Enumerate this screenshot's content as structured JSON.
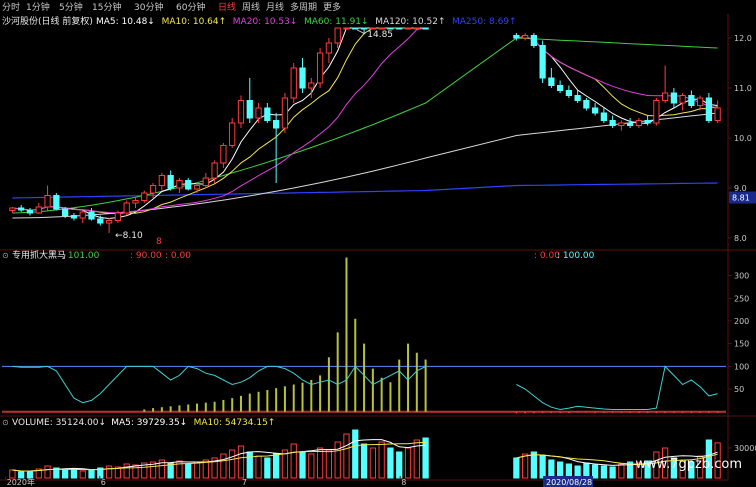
{
  "toolbar": {
    "periods": [
      "分时",
      "1分钟",
      "5分钟",
      "15分钟",
      "30分钟",
      "60分钟",
      "日线",
      "周线",
      "月线",
      "多周期",
      "更多"
    ],
    "active": "日线"
  },
  "colors": {
    "up": "#ff3b3b",
    "down": "#54ffff",
    "ma5": "#ffffff",
    "ma10": "#f2e64a",
    "ma20": "#e040e0",
    "ma60": "#3fd13f",
    "ma120": "#d8d8d8",
    "ma250": "#3040ff",
    "ind_line": "#3fd0d0",
    "ind_bar": "#b7c23a",
    "ind_ref": "#5a8cff"
  },
  "chart_data": [
    {
      "type": "candlestick",
      "title": "沙河股份(日线 前复权)",
      "indicators": [
        {
          "name": "MA5",
          "value": "10.48",
          "arrow": "↓"
        },
        {
          "name": "MA10",
          "value": "10.64",
          "arrow": "↑"
        },
        {
          "name": "MA20",
          "value": "10.53",
          "arrow": "↓"
        },
        {
          "name": "MA60",
          "value": "11.91",
          "arrow": "↓"
        },
        {
          "name": "MA120",
          "value": "10.52",
          "arrow": "↑"
        },
        {
          "name": "MA250",
          "value": "8.69",
          "arrow": "↑"
        }
      ],
      "y_ticks": [
        "12.0",
        "11.0",
        "10.0",
        "9.0",
        "8.0"
      ],
      "ylim": [
        7.8,
        12.2
      ],
      "annotations": {
        "high": "14.85",
        "low": "8.10",
        "marker": "8",
        "price_tag": "8.81"
      },
      "segments": [
        {
          "start": 0,
          "count": 48,
          "gap_after": true
        },
        {
          "start": 48,
          "count": 24
        }
      ],
      "candles_seg1": [
        [
          8.55,
          8.62,
          8.5,
          8.6
        ],
        [
          8.6,
          8.66,
          8.52,
          8.56
        ],
        [
          8.56,
          8.6,
          8.45,
          8.5
        ],
        [
          8.5,
          8.7,
          8.48,
          8.62
        ],
        [
          8.62,
          9.05,
          8.55,
          8.85
        ],
        [
          8.85,
          8.9,
          8.55,
          8.58
        ],
        [
          8.58,
          8.62,
          8.4,
          8.45
        ],
        [
          8.45,
          8.5,
          8.35,
          8.4
        ],
        [
          8.4,
          8.55,
          8.3,
          8.52
        ],
        [
          8.52,
          8.6,
          8.35,
          8.38
        ],
        [
          8.38,
          8.45,
          8.25,
          8.3
        ],
        [
          8.3,
          8.4,
          8.1,
          8.35
        ],
        [
          8.35,
          8.55,
          8.3,
          8.5
        ],
        [
          8.5,
          8.75,
          8.45,
          8.7
        ],
        [
          8.7,
          8.8,
          8.6,
          8.75
        ],
        [
          8.75,
          8.95,
          8.7,
          8.9
        ],
        [
          8.9,
          9.1,
          8.8,
          9.05
        ],
        [
          9.05,
          9.3,
          8.95,
          9.25
        ],
        [
          9.25,
          9.35,
          8.95,
          9.0
        ],
        [
          9.0,
          9.2,
          8.9,
          9.15
        ],
        [
          9.15,
          9.2,
          8.95,
          8.98
        ],
        [
          8.98,
          9.1,
          8.9,
          9.05
        ],
        [
          9.05,
          9.3,
          9.0,
          9.2
        ],
        [
          9.2,
          9.55,
          9.1,
          9.5
        ],
        [
          9.5,
          9.9,
          9.4,
          9.85
        ],
        [
          9.85,
          10.4,
          9.8,
          10.3
        ],
        [
          10.3,
          10.85,
          10.2,
          10.75
        ],
        [
          10.75,
          11.2,
          10.3,
          10.4
        ],
        [
          10.4,
          10.7,
          10.3,
          10.6
        ],
        [
          10.6,
          10.7,
          10.3,
          10.35
        ],
        [
          10.35,
          10.5,
          9.1,
          10.2
        ],
        [
          10.2,
          10.9,
          10.1,
          10.8
        ],
        [
          10.8,
          11.5,
          10.7,
          11.4
        ],
        [
          11.4,
          11.6,
          10.9,
          11.0
        ],
        [
          11.0,
          11.2,
          10.8,
          11.1
        ],
        [
          11.1,
          11.8,
          11.0,
          11.7
        ],
        [
          11.7,
          12.0,
          11.5,
          11.9
        ],
        [
          11.9,
          13.1,
          11.8,
          13.0
        ],
        [
          13.0,
          14.3,
          12.9,
          14.2
        ],
        [
          14.2,
          14.85,
          13.4,
          13.5
        ],
        [
          13.5,
          13.9,
          12.1,
          12.3
        ],
        [
          12.3,
          13.2,
          12.2,
          13.1
        ],
        [
          13.1,
          13.9,
          13.0,
          13.8
        ],
        [
          13.8,
          14.1,
          13.1,
          13.2
        ],
        [
          13.2,
          13.3,
          12.8,
          12.9
        ],
        [
          12.9,
          13.6,
          12.8,
          13.5
        ],
        [
          13.5,
          14.5,
          13.4,
          14.4
        ],
        [
          14.4,
          15.2,
          13.9,
          14.2
        ]
      ],
      "candles_seg2": [
        [
          12.05,
          12.1,
          11.95,
          12.0
        ],
        [
          12.0,
          12.1,
          11.95,
          12.05
        ],
        [
          12.05,
          12.1,
          11.8,
          11.85
        ],
        [
          11.85,
          11.95,
          11.1,
          11.2
        ],
        [
          11.2,
          11.4,
          11.0,
          11.05
        ],
        [
          11.05,
          11.15,
          10.9,
          10.95
        ],
        [
          10.95,
          11.05,
          10.8,
          10.85
        ],
        [
          10.85,
          10.95,
          10.7,
          10.75
        ],
        [
          10.75,
          10.8,
          10.55,
          10.6
        ],
        [
          10.6,
          10.7,
          10.45,
          10.5
        ],
        [
          10.5,
          10.6,
          10.3,
          10.35
        ],
        [
          10.35,
          10.45,
          10.2,
          10.25
        ],
        [
          10.25,
          10.35,
          10.15,
          10.3
        ],
        [
          10.3,
          10.4,
          10.2,
          10.25
        ],
        [
          10.25,
          10.4,
          10.2,
          10.35
        ],
        [
          10.35,
          10.45,
          10.25,
          10.3
        ],
        [
          10.3,
          10.8,
          10.25,
          10.75
        ],
        [
          10.75,
          11.45,
          10.7,
          10.9
        ],
        [
          10.9,
          11.0,
          10.6,
          10.7
        ],
        [
          10.7,
          10.9,
          10.55,
          10.85
        ],
        [
          10.85,
          10.95,
          10.6,
          10.65
        ],
        [
          10.65,
          10.85,
          10.55,
          10.8
        ],
        [
          10.8,
          10.9,
          10.3,
          10.35
        ],
        [
          10.35,
          10.75,
          10.3,
          10.6
        ]
      ]
    },
    {
      "type": "bar",
      "title": "专用抓大黑马",
      "labels": [
        {
          "text": "101.00",
          "color": "#3fd13f"
        },
        {
          "text": "90.00",
          "color": "#ff3b3b"
        },
        {
          "text": "0.00",
          "color": "#ff3b3b"
        },
        {
          "text": "0.00",
          "color": "#ff3b3b"
        },
        {
          "text": "100.00",
          "color": "#54ffff"
        }
      ],
      "y_ticks": [
        "300",
        "250",
        "200",
        "150",
        "100",
        "50"
      ],
      "ylim": [
        -5,
        330
      ],
      "reference_line": 100,
      "bars_seg1": [
        0,
        0,
        0,
        0,
        0,
        0,
        0,
        0,
        0,
        0,
        0,
        0,
        0,
        0,
        0,
        5,
        8,
        10,
        12,
        14,
        16,
        18,
        20,
        22,
        26,
        30,
        35,
        40,
        44,
        48,
        52,
        56,
        60,
        64,
        70,
        80,
        120,
        175,
        340,
        205,
        150,
        95,
        75,
        65,
        115,
        150,
        130,
        115
      ],
      "line_seg1": [
        100,
        98,
        98,
        98,
        100,
        90,
        60,
        30,
        20,
        25,
        40,
        60,
        80,
        100,
        100,
        100,
        100,
        85,
        70,
        80,
        100,
        95,
        85,
        80,
        70,
        60,
        65,
        75,
        90,
        100,
        100,
        95,
        85,
        70,
        60,
        65,
        70,
        60,
        70,
        100,
        80,
        60,
        70,
        80,
        90,
        70,
        90,
        100
      ],
      "bars_seg2": [
        -4,
        -4,
        -4,
        -3,
        -3,
        -3,
        -3,
        -2,
        -2,
        -3,
        -3,
        -3,
        -3,
        -3,
        -3,
        -3,
        -3,
        -3,
        -3,
        -3,
        -3,
        -3,
        -3,
        -3
      ],
      "line_seg2": [
        60,
        50,
        35,
        20,
        10,
        5,
        8,
        12,
        10,
        8,
        6,
        5,
        5,
        5,
        5,
        5,
        8,
        100,
        80,
        60,
        70,
        55,
        35,
        40
      ]
    },
    {
      "type": "bar",
      "title": "VOLUME",
      "indicators": [
        {
          "name": "VOLUME",
          "value": "35124.00",
          "arrow": "↓"
        },
        {
          "name": "MA5",
          "value": "39729.35",
          "arrow": "↓"
        },
        {
          "name": "MA10",
          "value": "54734.15",
          "arrow": "↑"
        }
      ],
      "y_ticks": [
        "30000"
      ],
      "ylim": [
        0,
        50000
      ],
      "volume_seg1": [
        8000,
        6000,
        7000,
        9000,
        12000,
        10000,
        8000,
        9000,
        7000,
        8000,
        10000,
        12000,
        11000,
        14000,
        13000,
        15000,
        16000,
        18000,
        15000,
        17000,
        14000,
        16000,
        18000,
        20000,
        24000,
        28000,
        32000,
        26000,
        22000,
        20000,
        24000,
        28000,
        34000,
        26000,
        24000,
        30000,
        28000,
        36000,
        44000,
        48000,
        34000,
        30000,
        36000,
        30000,
        26000,
        30000,
        38000,
        40000
      ],
      "volume_seg2": [
        20000,
        24000,
        26000,
        22000,
        18000,
        16000,
        14000,
        12000,
        15000,
        13000,
        12000,
        11000,
        14000,
        16000,
        15000,
        17000,
        26000,
        30000,
        20000,
        18000,
        16000,
        22000,
        38000,
        35124
      ]
    }
  ],
  "x_axis_labels": [
    {
      "text": "2020年",
      "pos": 0.005
    },
    {
      "text": "6",
      "pos": 0.135
    },
    {
      "text": "7",
      "pos": 0.33
    },
    {
      "text": "8",
      "pos": 0.55
    },
    {
      "text": "2020/08/28",
      "pos": 0.75
    }
  ],
  "watermark": "www.7gpzb.com"
}
